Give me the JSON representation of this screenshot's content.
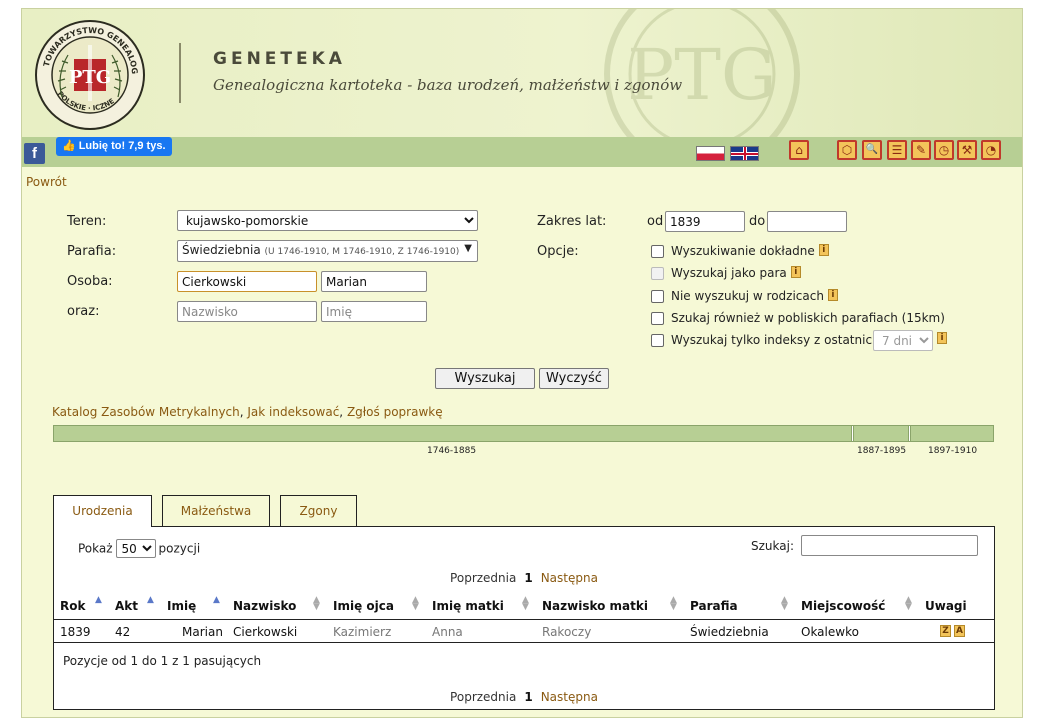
{
  "header": {
    "title": "GENETEKA",
    "subtitle": "Genealogiczna kartoteka - baza urodzeń, małżeństw i zgonów",
    "logo_icon": "ptg-seal-icon"
  },
  "social": {
    "facebook_icon": "f",
    "like_label": "Lubię to! 7,9 tys."
  },
  "toolbar": {
    "icons": [
      "home-icon",
      "map-icon",
      "search-icon",
      "list-icon",
      "edit-icon",
      "clock-icon",
      "tools-icon",
      "stats-icon"
    ],
    "icon_glyphs": [
      "⌂",
      "⬡",
      "🔍",
      "☰",
      "✎",
      "◷",
      "⚒",
      "◔"
    ]
  },
  "nav": {
    "back": "Powrót"
  },
  "form": {
    "teren_label": "Teren:",
    "teren_value": "kujawsko-pomorskie",
    "parafia_label": "Parafia:",
    "parafia_value": "Świedziebnia",
    "parafia_range": "(U 1746-1910, M 1746-1910, Z 1746-1910)",
    "osoba_label": "Osoba:",
    "osoba_nazwisko": "Cierkowski",
    "osoba_imie": "Marian",
    "oraz_label": "oraz:",
    "oraz_nazwisko_placeholder": "Nazwisko",
    "oraz_imie_placeholder": "Imię",
    "zakres_label": "Zakres lat:",
    "od_label": "od",
    "od_value": "1839",
    "do_label": "do",
    "do_value": "",
    "opcje_label": "Opcje:",
    "options": [
      "Wyszukiwanie dokładne",
      "Wyszukaj jako para",
      "Nie wyszukuj w rodzicach",
      "Szukaj również w pobliskich parafiach (15km)",
      "Wyszukaj tylko indeksy z ostatnich"
    ],
    "last_days_value": "7 dni",
    "info_glyph": "i",
    "search_button": "Wyszukaj",
    "clear_button": "Wyczyść"
  },
  "links": {
    "katalog": "Katalog Zasobów Metrykalnych",
    "jak": "Jak indeksować",
    "zglos": "Zgłoś poprawkę",
    "sep": ", "
  },
  "timeline": {
    "labels": [
      "1746-1885",
      "1887-1895",
      "1897-1910"
    ]
  },
  "tabs": [
    "Urodzenia",
    "Małżeństwa",
    "Zgony"
  ],
  "table": {
    "pokaz_label": "Pokaż",
    "page_size": "50",
    "pozycji_label": "pozycji",
    "szukaj_label": "Szukaj:",
    "prev": "Poprzednia",
    "page": "1",
    "next": "Następna",
    "columns": [
      "Rok",
      "Akt",
      "Imię",
      "Nazwisko",
      "Imię ojca",
      "Imię matki",
      "Nazwisko matki",
      "Parafia",
      "Miejscowość",
      "Uwagi"
    ],
    "rows": [
      {
        "rok": "1839",
        "akt": "42",
        "imie": "Marian",
        "nazwisko": "Cierkowski",
        "imie_ojca": "Kazimierz",
        "imie_matki": "Anna",
        "nazwisko_matki": "Rakoczy",
        "parafia": "Świedziebnia",
        "miejscowosc": "Okalewko",
        "uwagi": [
          "Z",
          "A"
        ]
      }
    ],
    "summary": "Pozycje od 1 do 1 z 1 pasujących"
  }
}
